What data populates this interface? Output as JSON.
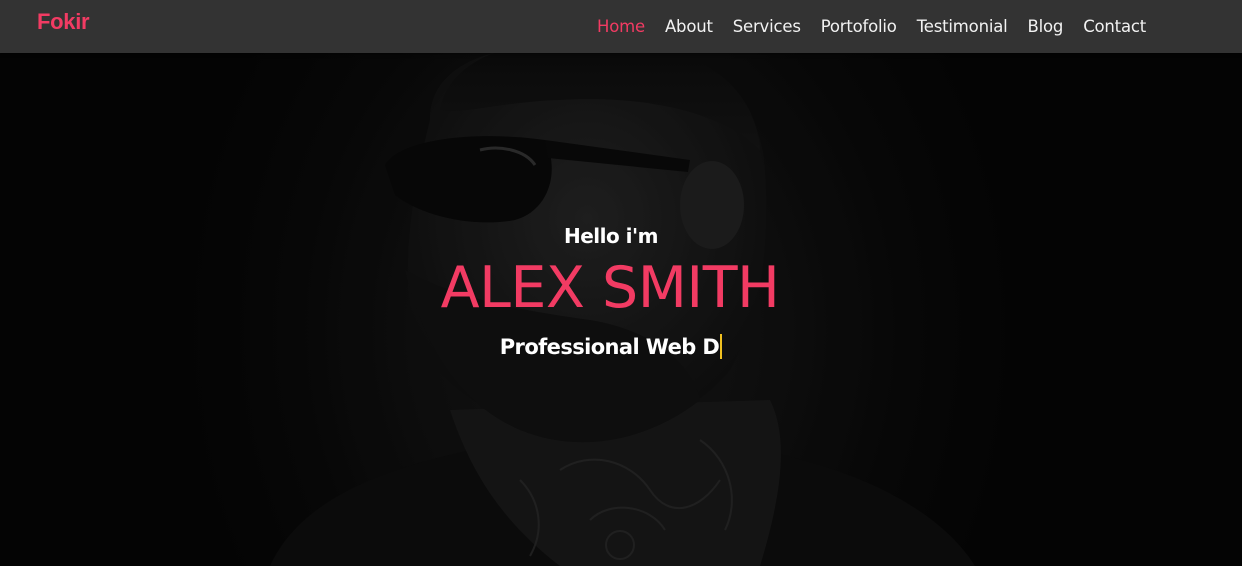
{
  "brand": {
    "name": "Fokir",
    "color": "#f23b63"
  },
  "nav": {
    "items": [
      {
        "label": "Home",
        "active": true
      },
      {
        "label": "About",
        "active": false
      },
      {
        "label": "Services",
        "active": false
      },
      {
        "label": "Portofolio",
        "active": false
      },
      {
        "label": "Testimonial",
        "active": false
      },
      {
        "label": "Blog",
        "active": false
      },
      {
        "label": "Contact",
        "active": false
      }
    ]
  },
  "hero": {
    "greeting": "Hello i'm",
    "name": "ALEX SMITH",
    "typed_text": "Professional Web D",
    "background_image": "dark portrait of bearded man with sunglasses and neck tattoos",
    "accent_color": "#f23b63"
  }
}
